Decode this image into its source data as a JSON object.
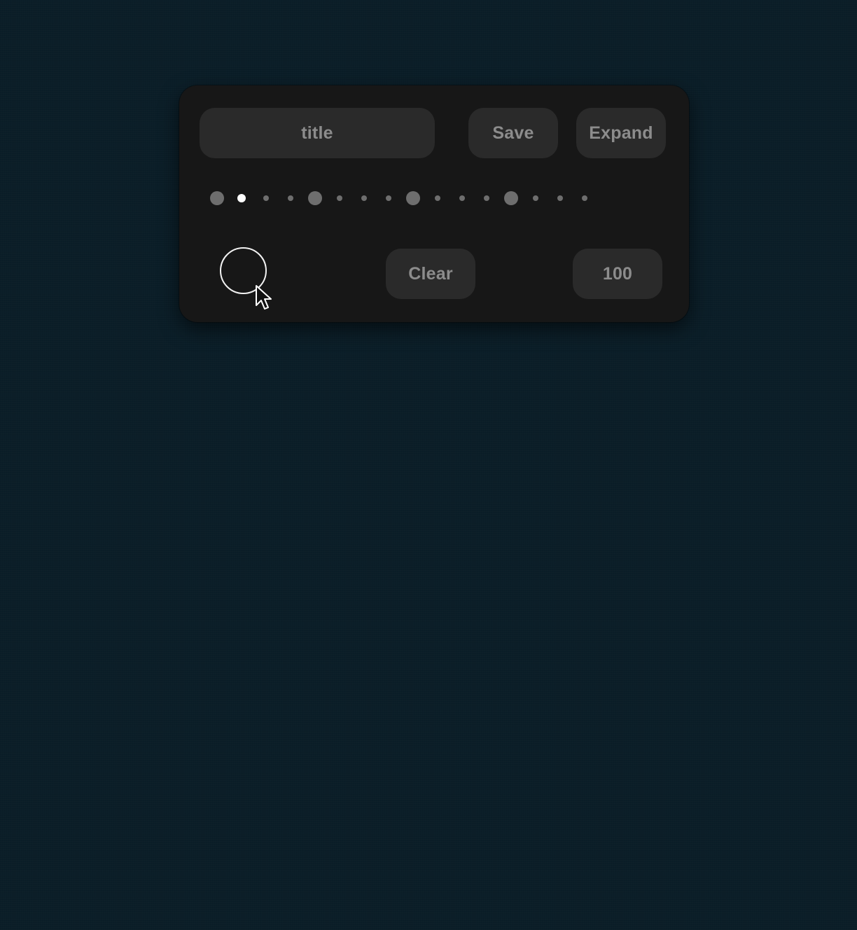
{
  "toolbar": {
    "title_label": "title",
    "save_label": "Save",
    "expand_label": "Expand"
  },
  "controls": {
    "clear_label": "Clear",
    "value_label": "100"
  },
  "dots": {
    "count": 16,
    "active_index": 1,
    "major_every": 4
  },
  "colors": {
    "background": "#0b1e28",
    "panel": "#171717",
    "pill": "#2a2a2a",
    "pill_text": "#8c8c8c",
    "dot": "#6e6e6e",
    "dot_active": "#ffffff",
    "ring": "#f2f2f2"
  },
  "icons": {
    "ring": "circle-outline-icon",
    "cursor": "mouse-pointer-icon"
  }
}
